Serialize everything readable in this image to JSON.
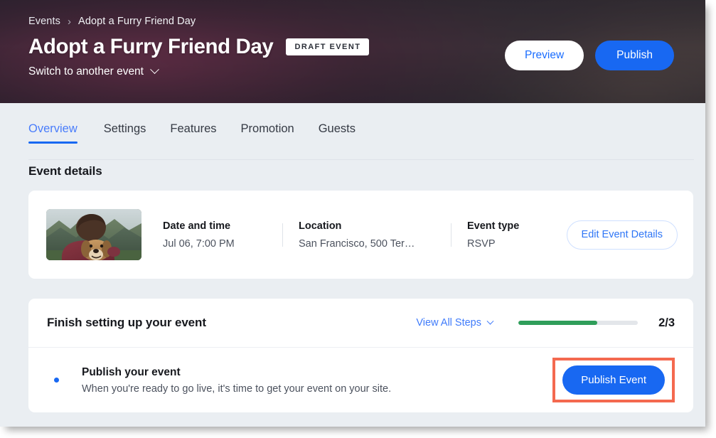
{
  "header": {
    "breadcrumb": {
      "root": "Events",
      "separator": "›",
      "current": "Adopt a Furry Friend Day"
    },
    "title": "Adopt a Furry Friend Day",
    "status_badge": "DRAFT EVENT",
    "switch_event_label": "Switch to another event",
    "preview_label": "Preview",
    "publish_label": "Publish",
    "accent_blue": "#1868f2",
    "preview_text_color": "#1a6dff"
  },
  "tabs": [
    {
      "label": "Overview",
      "active": true
    },
    {
      "label": "Settings",
      "active": false
    },
    {
      "label": "Features",
      "active": false
    },
    {
      "label": "Promotion",
      "active": false
    },
    {
      "label": "Guests",
      "active": false
    }
  ],
  "main": {
    "section_heading": "Event details",
    "event_details": {
      "thumbnail_alt": "person hugging a golden retriever with mountains behind",
      "fields": [
        {
          "label": "Date and time",
          "value": "Jul 06, 7:00 PM"
        },
        {
          "label": "Location",
          "value": "San Francisco, 500 Ter…"
        },
        {
          "label": "Event type",
          "value": "RSVP"
        }
      ],
      "edit_button_label": "Edit Event Details"
    },
    "setup": {
      "title": "Finish setting up your event",
      "view_all_steps_label": "View All Steps",
      "progress_count": "2/3",
      "progress_percent": 66,
      "progress_color": "#2f9e5a",
      "progress_track_color": "#e3e6ea",
      "step": {
        "title": "Publish your event",
        "description": "When you're ready to go live, it's time to get your event on your site.",
        "action_label": "Publish Event",
        "highlight_color": "#f4694f"
      }
    }
  }
}
